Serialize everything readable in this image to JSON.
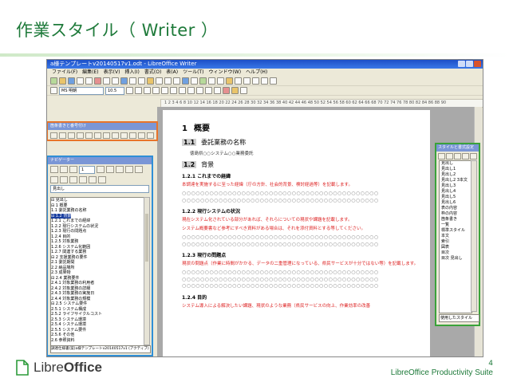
{
  "slide": {
    "title": "作業スタイル（ Writer ）",
    "page_number": "4",
    "suite": "LibreOffice Productivity Suite",
    "logo_text_a": "Libre",
    "logo_text_b": "Office"
  },
  "window": {
    "title": "a様テンプレートv20140517v1.odt - LibreOffice Writer",
    "menus": [
      "ファイル(F)",
      "編集(E)",
      "表示(V)",
      "挿入(I)",
      "書式(O)",
      "表(A)",
      "ツール(T)",
      "ウィンドウ(W)",
      "ヘルプ(H)"
    ],
    "font_name": "MS 明朝",
    "font_size": "10.5",
    "ruler": "1 2 3 4 6 8 10 12 14 16 18 20 22 24 26 28 30 32 34 36 38 40 42 44 46 48 50 52 54 56 58 60 62 64 66 68 70 72 74 76 78 80 82 84 86 88 90"
  },
  "orange_panel": {
    "title": "箇条書きと番号付け"
  },
  "navigator": {
    "title": "ナビゲーター",
    "spin_value": "1",
    "select": "見出し",
    "items": [
      {
        "text": "⊟ 見出し",
        "hl": false
      },
      {
        "text": "  ⊟ 1 概要",
        "hl": false
      },
      {
        "text": "      1.1 委託業務の名称",
        "hl": false
      },
      {
        "text": "    ⊟ 1.2 背景",
        "hl": true
      },
      {
        "text": "        1.2.1 これまでの経緯",
        "hl": false
      },
      {
        "text": "        1.2.2 現行システムの状況",
        "hl": false
      },
      {
        "text": "        1.2.3 現行の問題点",
        "hl": false
      },
      {
        "text": "        1.2.4 目的",
        "hl": false
      },
      {
        "text": "        1.2.5 対象業務",
        "hl": false
      },
      {
        "text": "        1.2.6 システム化範囲",
        "hl": false
      },
      {
        "text": "        1.2.7 関連する業務",
        "hl": false
      },
      {
        "text": "  ⊟ 2 支援業務の要件",
        "hl": false
      },
      {
        "text": "      2.1 委託期間",
        "hl": false
      },
      {
        "text": "      2.2 納品場所",
        "hl": false
      },
      {
        "text": "      2.3 成果物",
        "hl": false
      },
      {
        "text": "    ⊟ 2.4 業務要件",
        "hl": false
      },
      {
        "text": "        2.4.1 対象業務の利用者",
        "hl": false
      },
      {
        "text": "        2.4.2 対象業務の詳細",
        "hl": false
      },
      {
        "text": "        2.4.3 対象業務の実施日",
        "hl": false
      },
      {
        "text": "        2.4.4 対象業務の規模",
        "hl": false
      },
      {
        "text": "    ⊟ 2.5 システム要件",
        "hl": false
      },
      {
        "text": "        2.5.1 システム構成",
        "hl": false
      },
      {
        "text": "        2.5.2 ライフサイクルコスト",
        "hl": false
      },
      {
        "text": "        2.5.3 システム環境",
        "hl": false
      },
      {
        "text": "        2.5.4 システム環境",
        "hl": false
      },
      {
        "text": "        2.5.5 システム要件",
        "hl": false
      },
      {
        "text": "        2.5.6 その他",
        "hl": false
      },
      {
        "text": "      2.6 参照資料",
        "hl": false
      }
    ],
    "status": "調達仕様書(案)a様テンプレートv20140517v1 (アクティブ)"
  },
  "document": {
    "h1_num": "1",
    "h1_text": "概要",
    "s11_num": "1.1",
    "s11_text": "委託業務の名称",
    "s11_note": "徳島県○○システム○○業務委託",
    "s12_num": "1.2",
    "s12_text": "背景",
    "h121": "1.2.1 これまでの経緯",
    "red121": "本調達を実施するに至った経緯（庁の方針、社会的背景、検討経過等）を記載します。",
    "circ_a": "○○○○○○○○○○○○○○○○○○○○○○○○○○○○○○○○○○○○○○○○○○○",
    "circ_b": "○○○○○○○○○○○○○○○○○○○○○○○○○○○○○○○○○○○○○○○○○○○",
    "h122": "1.2.2 現行システムの状況",
    "red122a": "現在システム化されている部分があれば、それらについての現状や課題を記載します。",
    "red122b": "システム概要書など参考にすべき資料がある場合は、それを添付資料とする等してください。",
    "circ_c": "○○○○○○○○○○○○○○○○○○○○○○○○○○○○○○○○○○○○○○○○○○○",
    "circ_d": "○○○○○○○○○○○○○○○○○○○○○○○○○○○○○○○○○○○○○○○○○○○",
    "h123": "1.2.3 現行の問題点",
    "red123a": "現状の問題点（作業に時間がかかる、データの二重管理になっている、県民サービスが十分ではない等）を記載します。",
    "circ_e": "○○○○○○○○○○○○○○○○○○○○○○○○○○○○○○○○○○○○○○○○○○○",
    "circ_f": "○○○○○○○○○○○○○○○○○○○○○○○○○○○○○○○○○○○○○○○○○○○",
    "circ_g": "○○○○○○○○○○○○○○○○○○○○○○○○○○○○○○○○○○○○○○○○○○○",
    "h124": "1.2.4 目的",
    "red124": "システム導入による解決したい課題、現状のような業務（県民サービスの向上、作業効率の改善"
  },
  "styles_panel": {
    "title": "スタイルと書式設定",
    "items": [
      "見出し",
      "見出し1",
      "見出し2",
      "見出し2 3本文",
      "見出し3",
      "見出し4",
      "見出し5",
      "見出し6",
      "表の内容",
      "枠の内容",
      "箇条書き",
      "一覧",
      "標準スタイル",
      "本文",
      "索引",
      "図表",
      "目次",
      "目次 見出し"
    ],
    "footer": "使用したスタイル"
  }
}
